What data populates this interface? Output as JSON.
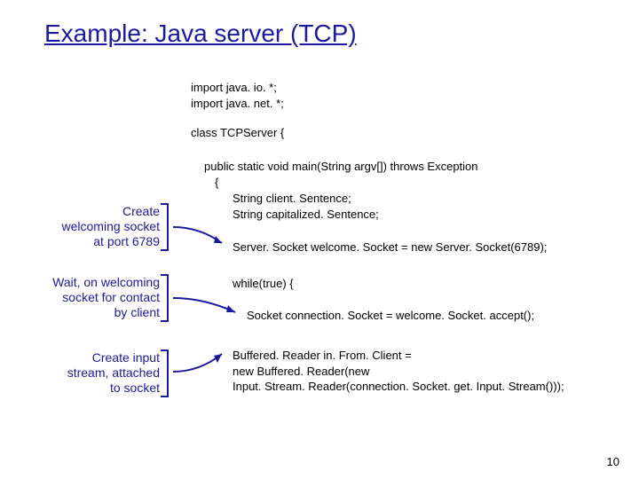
{
  "title": "Example: Java server (TCP)",
  "imports": {
    "line1": "import java. io. *;",
    "line2": "import java. net. *;"
  },
  "class_decl": "class TCPServer {",
  "main_sig": "public static void main(String argv[]) throws Exception",
  "brace": "{",
  "strings": {
    "l1": "String client. Sentence;",
    "l2": "String capitalized. Sentence;"
  },
  "welcome_socket": "Server. Socket welcome. Socket = new Server. Socket(6789);",
  "while_stmt": "while(true) {",
  "conn_socket": "Socket connection. Socket = welcome. Socket. accept();",
  "buffered": {
    "l1": "Buffered. Reader in. From. Client =",
    "l2": "   new Buffered. Reader(new",
    "l3": "   Input. Stream. Reader(connection. Socket. get. Input. Stream()));"
  },
  "annotations": {
    "a1": {
      "l1": "Create",
      "l2": "welcoming socket",
      "l3": "at port 6789"
    },
    "a2": {
      "l1": "Wait, on welcoming",
      "l2": "socket for contact",
      "l3": "by client"
    },
    "a3": {
      "l1": "Create input",
      "l2": "stream, attached",
      "l3": "to socket"
    }
  },
  "pagenum": "10"
}
